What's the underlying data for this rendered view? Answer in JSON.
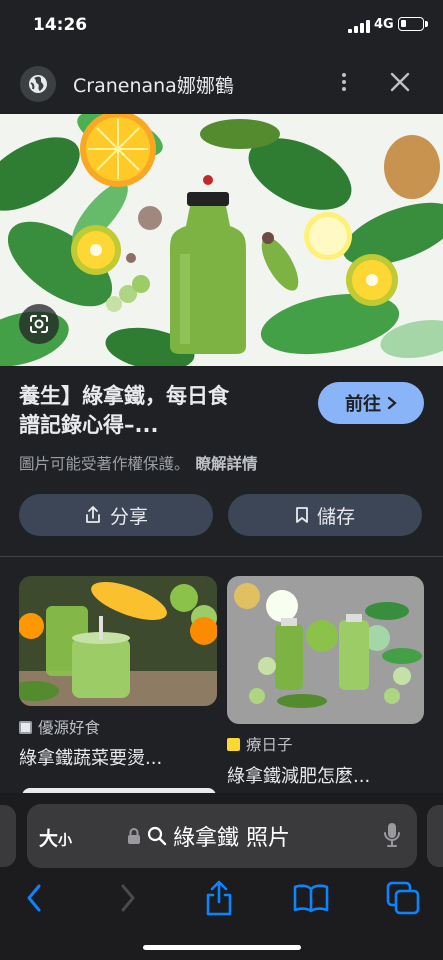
{
  "status": {
    "time": "14:26",
    "network": "4G"
  },
  "header": {
    "title": "Cranenana娜娜鶴",
    "site_icon": "globe-icon",
    "menu_icon": "more-vert-icon",
    "close_icon": "close-icon"
  },
  "result": {
    "title_line1": "養生】綠拿鐵，每日食",
    "title_line2": "譜記錄心得–...",
    "visit_label": "前往",
    "notice": "圖片可能受著作權保護。",
    "learn_more": "瞭解詳情",
    "share_label": "分享",
    "save_label": "儲存"
  },
  "related": [
    {
      "source": "優源好食",
      "caption": "綠拿鐵蔬菜要燙..."
    },
    {
      "source": "療日子",
      "caption": "綠拿鐵減肥怎麼..."
    }
  ],
  "browser": {
    "text_size_label": "大",
    "text_size_small": "小",
    "url_query": "綠拿鐵 照片"
  },
  "colors": {
    "accent": "#8ab4f8",
    "background": "#202124",
    "button": "#3c4657"
  }
}
